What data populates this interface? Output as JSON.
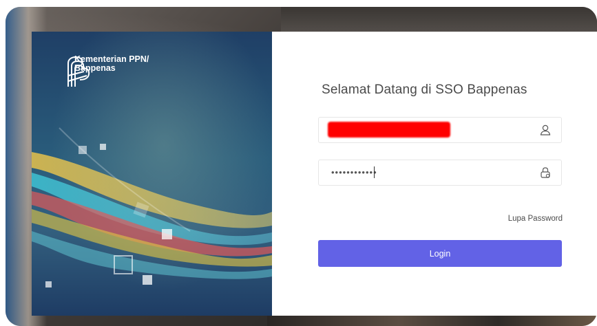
{
  "brand": {
    "line1": "Kementerian PPN/",
    "line2": "Bappenas"
  },
  "login_form": {
    "title": "Selamat Datang di SSO Bappenas",
    "username": {
      "value": "",
      "redacted": true,
      "icon": "user-icon"
    },
    "password": {
      "value": "••••••••••••",
      "icon": "lock-icon"
    },
    "forgot_label": "Lupa Password",
    "login_label": "Login"
  },
  "colors": {
    "accent": "#6262e6",
    "panel_blue": "#1f3f66",
    "redaction": "#ff0000"
  }
}
